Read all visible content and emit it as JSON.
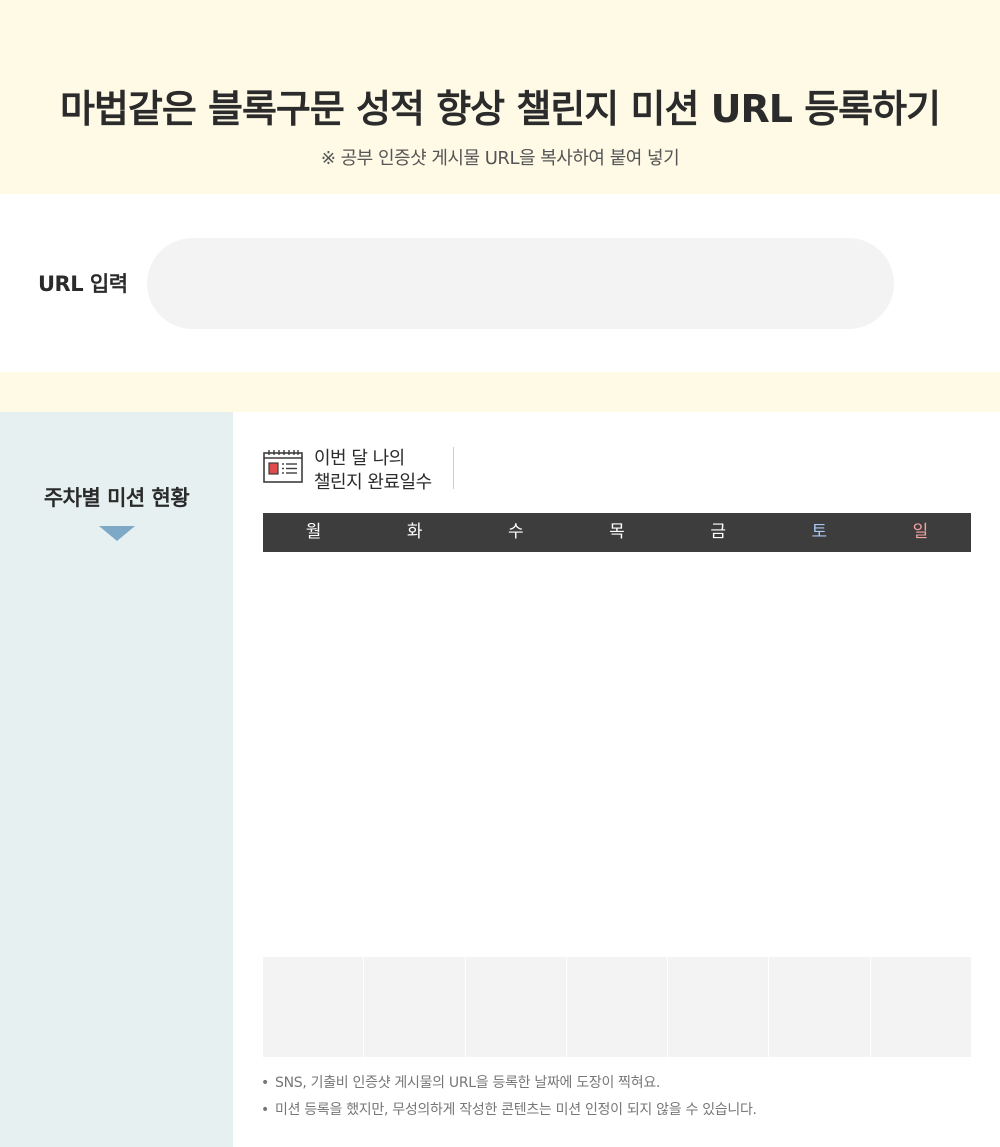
{
  "hero": {
    "title": "마법같은 블록구문 성적 향상 챌린지 미션 URL 등록하기",
    "subtitle": "※ 공부 인증샷 게시물 URL을 복사하여 붙여 넣기"
  },
  "url_form": {
    "label": "URL 입력",
    "value": "",
    "placeholder": ""
  },
  "sidebar": {
    "title": "주차별 미션 현황",
    "arrow_icon": "caret-down-icon"
  },
  "count_box": {
    "icon": "calendar-icon",
    "label_line1": "이번 달 나의",
    "label_line2": "챌린지 완료일수"
  },
  "weekdays": [
    "월",
    "화",
    "수",
    "목",
    "금",
    "토",
    "일"
  ],
  "stamps_filled": [
    false,
    false,
    false,
    false,
    false,
    false,
    false
  ],
  "notes": [
    "SNS, 기출비 인증샷 게시물의 URL을 등록한 날짜에 도장이 찍혀요.",
    "미션 등록을 했지만, 무성의하게 작성한 콘텐츠는 미션 인정이 되지 않을 수 있습니다."
  ],
  "colors": {
    "cream": "#fefae6",
    "sidebar_bg": "#e7f0f0",
    "header_bg": "#3d3d3d",
    "saturday": "#a9c7f0",
    "sunday": "#f4a3a3",
    "arrow": "#7ea9c6"
  }
}
